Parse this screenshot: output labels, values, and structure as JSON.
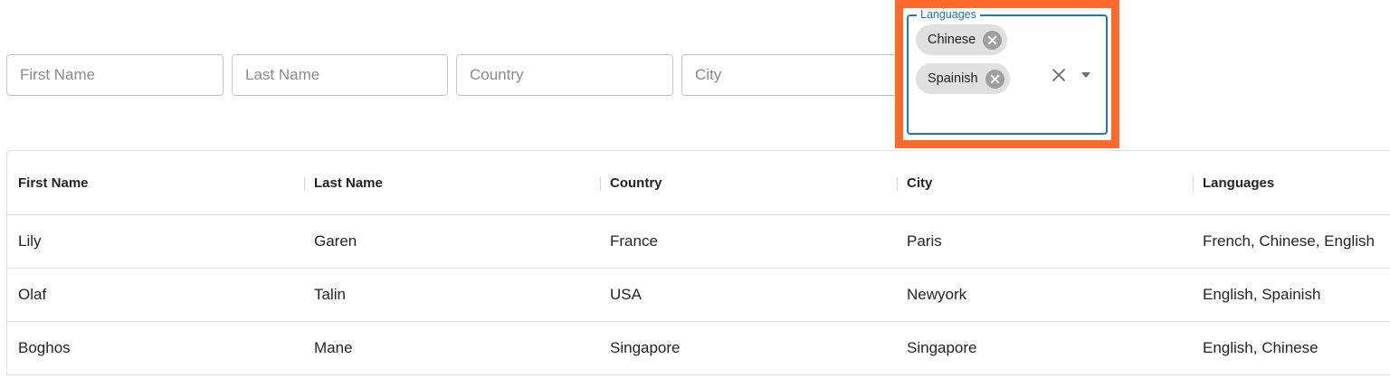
{
  "filters": {
    "first_name": {
      "placeholder": "First Name",
      "value": ""
    },
    "last_name": {
      "placeholder": "Last Name",
      "value": ""
    },
    "country": {
      "placeholder": "Country",
      "value": ""
    },
    "city": {
      "placeholder": "City",
      "value": ""
    },
    "languages": {
      "label": "Languages",
      "selected": [
        "Chinese",
        "Spainish"
      ],
      "clear_icon": "close-icon",
      "dropdown_icon": "arrow-drop-down-icon",
      "chip_delete_icon": "cancel-circle-icon"
    }
  },
  "highlight_color": "#ff6a2b",
  "accent_color": "#1f78b4",
  "table": {
    "columns": [
      "First Name",
      "Last Name",
      "Country",
      "City",
      "Languages"
    ],
    "rows": [
      [
        "Lily",
        "Garen",
        "France",
        "Paris",
        "French, Chinese, English"
      ],
      [
        "Olaf",
        "Talin",
        "USA",
        "Newyork",
        "English, Spainish"
      ],
      [
        "Boghos",
        "Mane",
        "Singapore",
        "Singapore",
        "English, Chinese"
      ]
    ]
  }
}
